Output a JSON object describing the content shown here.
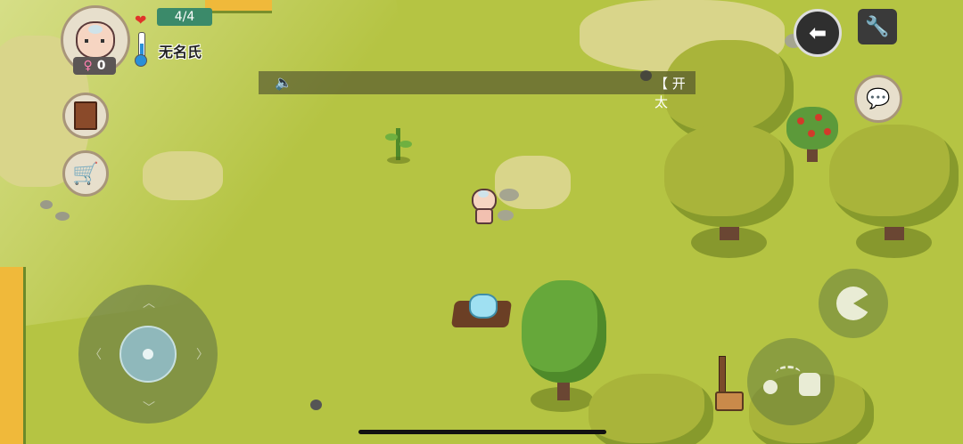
{
  "player": {
    "hp_text": "4/4",
    "name": "无名氏",
    "gender_symbol": "♀",
    "gender_count": "0"
  },
  "broadcast": {
    "text": "【 开太"
  },
  "buttons": {
    "back_icon": "arrow-left-icon",
    "settings_icon": "wrench-icon",
    "chat_icon": "chat-bubble-icon",
    "journal_icon": "book-icon",
    "shop_icon": "cart-icon",
    "eat_icon": "eat-icon",
    "throw_icon": "throw-icon"
  },
  "colors": {
    "grass": "#b5c443",
    "hp_bar": "#3b8a6a",
    "hud_ring": "#e7dfcc"
  }
}
